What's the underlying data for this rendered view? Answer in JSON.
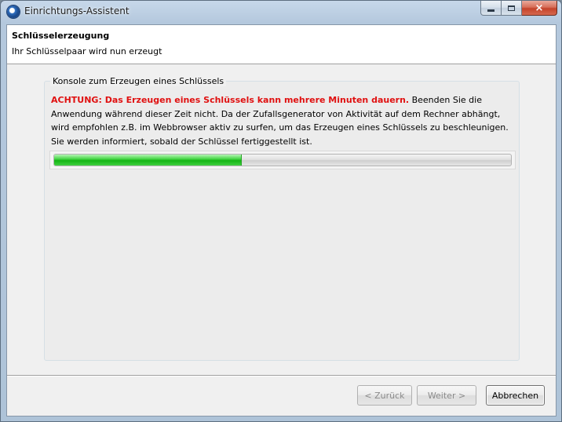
{
  "window": {
    "title": "Einrichtungs-Assistent",
    "icon": "app-logo-icon",
    "controls": {
      "minimize": "minimize-icon",
      "maximize": "maximize-icon",
      "close": "×"
    }
  },
  "header": {
    "title": "Schlüsselerzeugung",
    "subtitle": "Ihr Schlüsselpaar wird nun erzeugt"
  },
  "console": {
    "label": "Konsole zum Erzeugen eines Schlüssels",
    "warning": "ACHTUNG: Das Erzeugen eines Schlüssels kann mehrere Minuten dauern.",
    "message": " Beenden Sie die Anwendung während dieser Zeit nicht. Da der Zufallsgenerator von Aktivität auf dem Rechner abhängt, wird empfohlen z.B. im Webbrowser aktiv zu surfen, um das Erzeugen eines Schlüssels zu beschleunigen. Sie werden informiert, sobald der Schlüssel fertiggestellt ist.",
    "progress_fraction": 0.41
  },
  "buttons": {
    "back": "< Zurück",
    "next": "Weiter >",
    "cancel": "Abbrechen"
  },
  "colors": {
    "warning": "#e01010",
    "progress": "#14b414"
  }
}
